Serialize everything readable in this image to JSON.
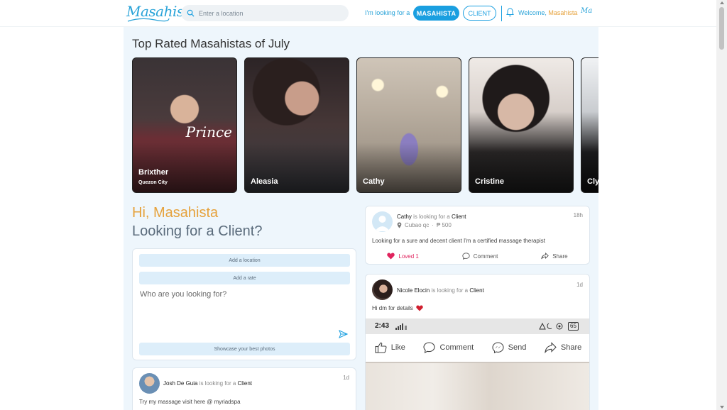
{
  "header": {
    "logo": "Masahista",
    "search_placeholder": "Enter a location",
    "looking_label": "I'm looking for a",
    "btn_masahista": "MASAHISTA",
    "btn_client": "CLIENT",
    "welcome_prefix": "Welcome,",
    "welcome_user": "Masahista",
    "mini_logo": "Ma"
  },
  "top_rated": {
    "title": "Top Rated Masahistas of July",
    "cards": [
      {
        "name": "Brixther",
        "city": "Quezon City",
        "overlay": "Prince"
      },
      {
        "name": "Aleasia",
        "city": ""
      },
      {
        "name": "Cathy",
        "city": ""
      },
      {
        "name": "Cristine",
        "city": ""
      },
      {
        "name": "Cly",
        "city": ""
      }
    ]
  },
  "greeting": {
    "hi": "Hi, Masahista",
    "question": "Looking for a Client?"
  },
  "compose": {
    "add_location": "Add a location",
    "add_rate": "Add a rate",
    "placeholder": "Who are you looking for?",
    "showcase": "Showcase your best photos"
  },
  "posts": {
    "josh": {
      "name": "Josh De Guia",
      "looking": "is looking for a",
      "target": "Client",
      "time": "1d",
      "body": "Try my massage visit here @ myriadspa"
    },
    "cathy": {
      "name": "Cathy",
      "looking": "is looking for a",
      "target": "Client",
      "time": "18h",
      "location": "Cubao qc",
      "rate": "₱ 500",
      "body": "Looking for a sure and decent client I'm a certified massage therapist",
      "loved": "Loved 1",
      "comment": "Comment",
      "share": "Share"
    },
    "nicole": {
      "name": "Nicole Elocin",
      "looking": "is looking for a",
      "target": "Client",
      "time": "1d",
      "body": "Hi dm for details",
      "embed": {
        "clock": "2:43",
        "battery": "65",
        "like": "Like",
        "comment": "Comment",
        "send": "Send",
        "share": "Share"
      }
    }
  },
  "colors": {
    "accent": "#1a9fe0",
    "gold": "#e6a23c",
    "background": "#eef6fc"
  }
}
